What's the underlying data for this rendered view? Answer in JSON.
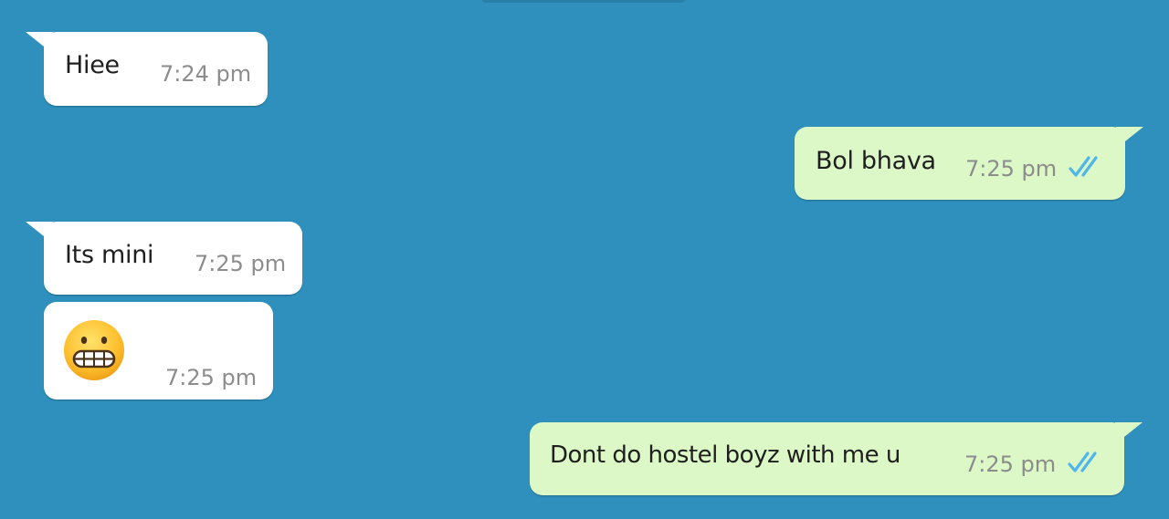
{
  "chat": {
    "messages": [
      {
        "direction": "incoming",
        "text": "Hiee",
        "time": "7:24 pm"
      },
      {
        "direction": "outgoing",
        "text": "Bol bhava",
        "time": "7:25 pm",
        "status": "read",
        "status_icon": "double-check-icon"
      },
      {
        "direction": "incoming",
        "text": "Its mini",
        "time": "7:25 pm"
      },
      {
        "direction": "incoming",
        "emoji": "grimacing-face-icon",
        "time": "7:25 pm"
      },
      {
        "direction": "outgoing",
        "text": "Dont do hostel boyz with me u",
        "time": "7:25 pm",
        "status": "read",
        "status_icon": "double-check-icon"
      }
    ]
  },
  "colors": {
    "background": "#2F90BD",
    "incoming_bubble": "#FFFFFF",
    "outgoing_bubble": "#DCF8C6",
    "read_ticks": "#4FB6EC",
    "timestamp": "#8C8C8C"
  }
}
